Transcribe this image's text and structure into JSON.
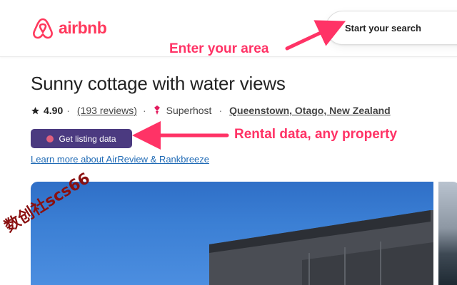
{
  "header": {
    "logo_text": "airbnb",
    "search_label": "Start your search"
  },
  "annotations": {
    "area": "Enter your area",
    "rental": "Rental data, any property"
  },
  "listing": {
    "title": "Sunny cottage with water views",
    "rating": "4.90",
    "reviews": "(193 reviews)",
    "separator": "·",
    "superhost": "Superhost",
    "location": "Queenstown, Otago, New Zealand"
  },
  "extension": {
    "button_label": "Get listing data",
    "learn_more": "Learn more about AirReview & Rankbreeze"
  },
  "watermark": "数创社scs66",
  "colors": {
    "brand": "#ff385c",
    "annotation": "#ff3366",
    "button_bg": "#4b3a80",
    "link": "#1f6ab5",
    "watermark": "#8a1010"
  },
  "icons": [
    "airbnb-logo-icon",
    "star-icon",
    "superhost-icon",
    "chart-icon",
    "arrow-icon"
  ]
}
